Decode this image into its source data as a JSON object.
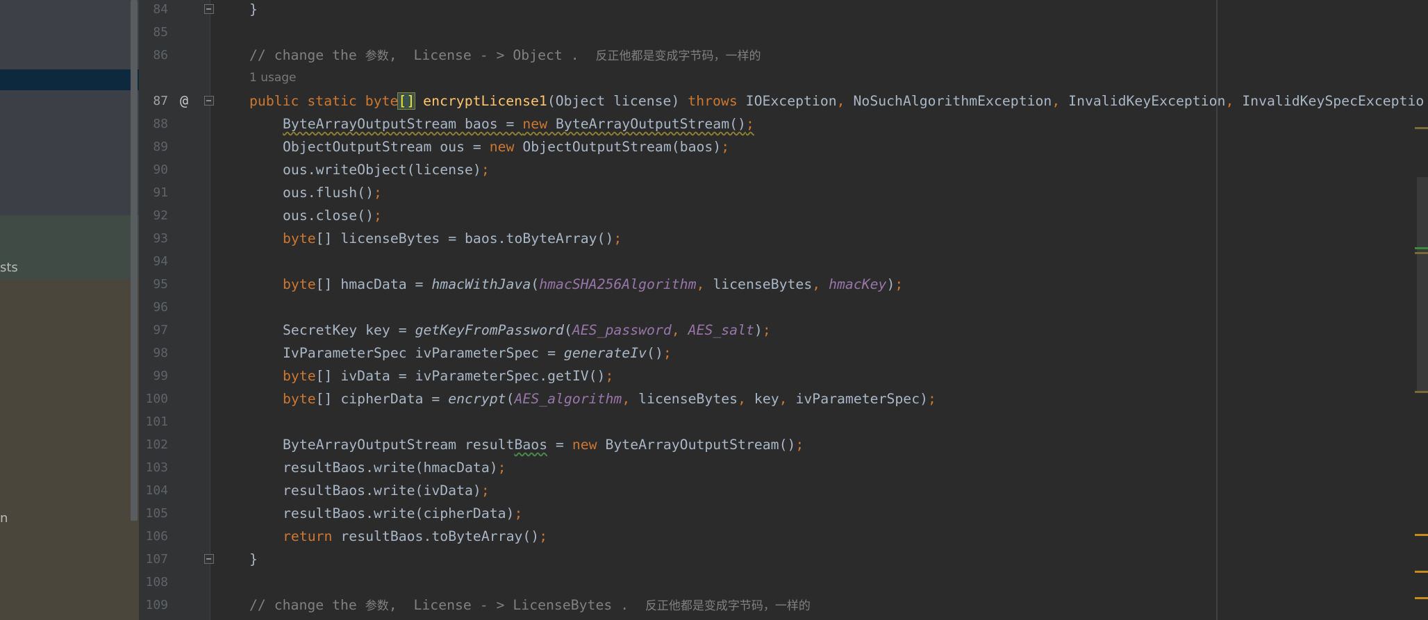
{
  "left_panel": {
    "clipped_texts": [
      "sts",
      "n"
    ]
  },
  "editor": {
    "lines": [
      {
        "num": "84"
      },
      {
        "num": "85"
      },
      {
        "num": "86"
      },
      {
        "num": "87"
      },
      {
        "num": "88"
      },
      {
        "num": "89"
      },
      {
        "num": "90"
      },
      {
        "num": "91"
      },
      {
        "num": "92"
      },
      {
        "num": "93"
      },
      {
        "num": "94"
      },
      {
        "num": "95"
      },
      {
        "num": "96"
      },
      {
        "num": "97"
      },
      {
        "num": "98"
      },
      {
        "num": "99"
      },
      {
        "num": "100"
      },
      {
        "num": "101"
      },
      {
        "num": "102"
      },
      {
        "num": "103"
      },
      {
        "num": "104"
      },
      {
        "num": "105"
      },
      {
        "num": "106"
      },
      {
        "num": "107"
      },
      {
        "num": "108"
      },
      {
        "num": "109"
      }
    ],
    "inlay_hint": "1 usage",
    "gutter_marker": "@",
    "tokens": {
      "brace_close": "}",
      "comment_1a": "// change the ",
      "comment_1b": "参数",
      "comment_1c": ",  License - > Object .  ",
      "comment_1d": "反正他都是变成字节码，一样的",
      "public": "public",
      "static": "static",
      "byte": "byte",
      "arr": "[]",
      "method_name": "encryptLicense1",
      "sig_params": "(Object license) ",
      "throws": "throws",
      "exceptions": [
        " IOException",
        " NoSuchAlgorithmException",
        " InvalidKeyException",
        " InvalidKeySpecExceptio"
      ],
      "comma": ",",
      "semi": ";",
      "new": "new",
      "return": "return",
      "l88_a": "ByteArrayOutputStream baos = ",
      "l88_b": " ByteArrayOutputStream()",
      "l89_a": "ObjectOutputStream ous = ",
      "l89_b": " ObjectOutputStream(baos)",
      "l90": "ous.writeObject(license)",
      "l91": "ous.flush()",
      "l92": "ous.close()",
      "l93": "[] licenseBytes = baos.toByteArray()",
      "l95_a": "[] hmacData = ",
      "l95_fn": "hmacWithJava",
      "l95_p1": "hmacSHA256Algorithm",
      "l95_mid": " licenseBytes",
      "l95_p2": "hmacKey",
      "l97_a": "SecretKey key = ",
      "l97_fn": "getKeyFromPassword",
      "l97_p1": "AES_password",
      "l97_p2": "AES_salt",
      "l98_a": "IvParameterSpec ivParameterSpec = ",
      "l98_fn": "generateIv",
      "l99": "[] ivData = ivParameterSpec.getIV()",
      "l100_a": "[] cipherData = ",
      "l100_fn": "encrypt",
      "l100_p1": "AES_algorithm",
      "l100_b": " licenseBytes",
      "l100_c": " key",
      "l100_d": " ivParameterSpec)",
      "l102_a": "ByteArrayOutputStream result",
      "l102_typo": "Baos",
      "l102_b": " = ",
      "l102_c": " ByteArrayOutputStream()",
      "l103": "resultBaos.write(hmacData)",
      "l104": "resultBaos.write(ivData)",
      "l105": "resultBaos.write(cipherData)",
      "l106": " resultBaos.toByteArray()",
      "open_paren": "(",
      "close_paren": ")",
      "comment_2a": "// change the ",
      "comment_2b": "参数",
      "comment_2c": ",  License - > LicenseBytes .  ",
      "comment_2d": "反正他都是变成字节码，一样的"
    }
  },
  "colors": {
    "keyword": "#cc7832",
    "method": "#ffc66d",
    "comment": "#808080",
    "static_field": "#9876aa",
    "text": "#a9b7c6"
  }
}
